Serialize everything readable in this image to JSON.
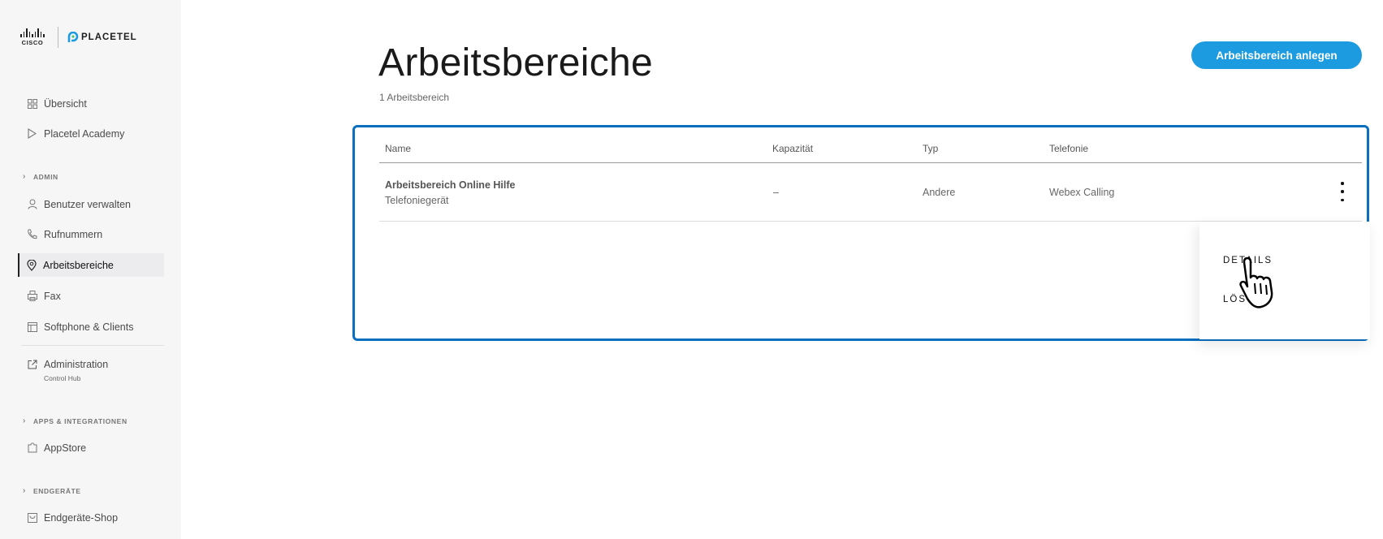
{
  "brand": {
    "cisco": "CISCO",
    "placetel": "PLACETEL",
    "accent": "#1d9be0",
    "focus_border": "#0b6fbf"
  },
  "sidebar": {
    "items": [
      {
        "label": "Übersicht",
        "icon": "grid-icon"
      },
      {
        "label": "Placetel Academy",
        "icon": "play-icon"
      }
    ],
    "admin_section": "ADMIN",
    "admin_items": [
      {
        "label": "Benutzer verwalten",
        "icon": "user-icon"
      },
      {
        "label": "Rufnummern",
        "icon": "phone-icon"
      },
      {
        "label": "Arbeitsbereiche",
        "icon": "location-pin-icon",
        "active": true
      },
      {
        "label": "Fax",
        "icon": "fax-icon"
      },
      {
        "label": "Softphone & Clients",
        "icon": "window-icon"
      }
    ],
    "administration": {
      "label": "Administration",
      "sub": "Control Hub",
      "icon": "external-link-icon"
    },
    "apps_section": "APPS & INTEGRATIONEN",
    "appstore": {
      "label": "AppStore",
      "icon": "puzzle-icon"
    },
    "devices_section": "ENDGERÄTE",
    "shop": {
      "label": "Endgeräte-Shop",
      "icon": "shop-icon"
    }
  },
  "main": {
    "title": "Arbeitsbereiche",
    "subtitle": "1 Arbeitsbereich",
    "create_button": "Arbeitsbereich anlegen",
    "table": {
      "columns": [
        "Name",
        "Kapazität",
        "Typ",
        "Telefonie"
      ],
      "rows": [
        {
          "name": "Arbeitsbereich Online Hilfe",
          "subname": "Telefoniegerät",
          "capacity": "–",
          "type": "Andere",
          "telephony": "Webex Calling"
        }
      ]
    },
    "row_menu": {
      "details": "DETAILS",
      "delete": "LÖSC"
    }
  }
}
